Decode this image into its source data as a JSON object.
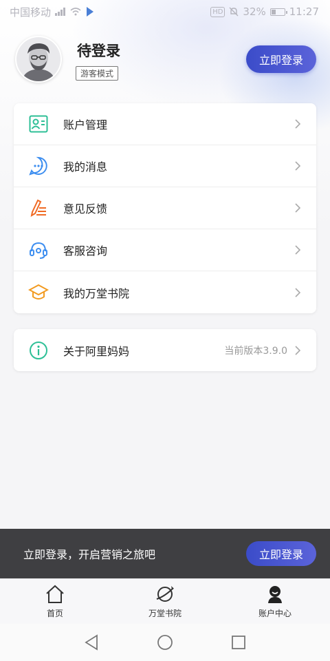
{
  "status_bar": {
    "carrier": "中国移动",
    "battery": "32%",
    "time": "11:27",
    "hd": "HD"
  },
  "profile": {
    "name": "待登录",
    "badge": "游客模式",
    "login_button": "立即登录"
  },
  "menu": [
    {
      "label": "账户管理",
      "icon": "account-card-icon",
      "color": "#2dbf96"
    },
    {
      "label": "我的消息",
      "icon": "message-bubble-icon",
      "color": "#3d8ef0"
    },
    {
      "label": "意见反馈",
      "icon": "feedback-pen-icon",
      "color": "#f06a24"
    },
    {
      "label": "客服咨询",
      "icon": "headset-icon",
      "color": "#3d8ef0"
    },
    {
      "label": "我的万堂书院",
      "icon": "graduation-cap-icon",
      "color": "#f29a1f"
    }
  ],
  "about": {
    "label": "关于阿里妈妈",
    "version": "当前版本3.9.0",
    "icon": "info-icon",
    "color": "#2dbf96"
  },
  "toast": {
    "text": "立即登录，开启营销之旅吧",
    "button": "立即登录"
  },
  "tabs": [
    {
      "label": "首页",
      "icon": "home-icon"
    },
    {
      "label": "万堂书院",
      "icon": "planet-icon"
    },
    {
      "label": "账户中心",
      "icon": "user-icon"
    }
  ],
  "colors": {
    "accent": "#3b4cc9",
    "toast_bg": "#3f3f42"
  }
}
